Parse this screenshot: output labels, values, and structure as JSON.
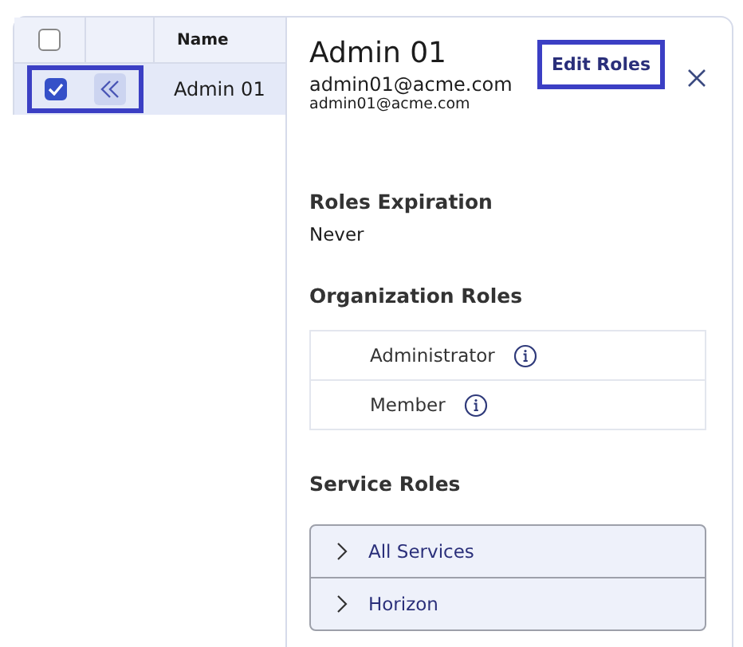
{
  "table": {
    "columns": [
      {
        "label": "Name"
      }
    ],
    "header_checked": false,
    "rows": [
      {
        "name": "Admin 01",
        "checked": true,
        "selected": true,
        "highlighted": true
      }
    ]
  },
  "panel": {
    "title": "Admin 01",
    "email": "admin01@acme.com",
    "subtitle": "admin01@acme.com",
    "edit_button": {
      "label": "Edit Roles",
      "highlighted": true
    },
    "sections": [
      {
        "kind": "text",
        "title": "Roles Expiration",
        "value": "Never"
      },
      {
        "kind": "list",
        "title": "Organization Roles",
        "items": [
          "Administrator",
          "Member"
        ]
      },
      {
        "kind": "accordion",
        "title": "Service Roles",
        "items": [
          {
            "label": "All Services",
            "expanded": false
          },
          {
            "label": "Horizon",
            "expanded": false
          }
        ]
      }
    ]
  }
}
